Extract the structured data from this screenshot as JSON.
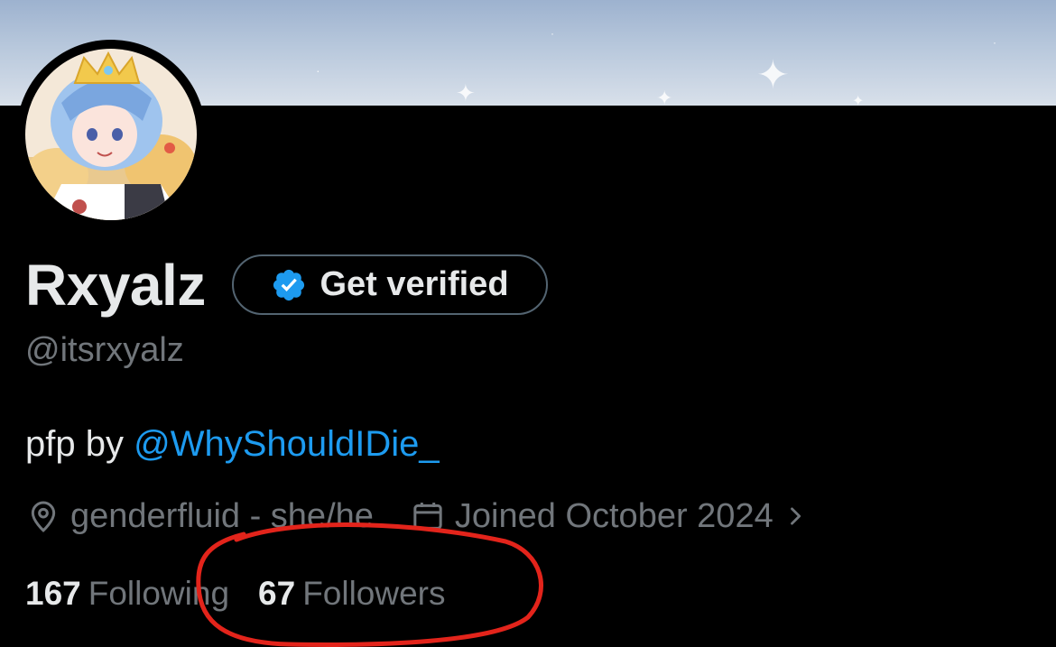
{
  "profile": {
    "display_name": "Rxyalz",
    "handle": "@itsrxyalz",
    "get_verified_label": "Get verified",
    "bio_prefix": "pfp by",
    "bio_mention": "@WhyShouldIDie_",
    "location": "genderfluid - she/he",
    "joined": "Joined October 2024",
    "following_count": "167",
    "following_label": "Following",
    "followers_count": "67",
    "followers_label": "Followers"
  },
  "colors": {
    "background": "#000000",
    "text_primary": "#e7e9ea",
    "text_secondary": "#71767b",
    "accent": "#1d9bf0",
    "annotation": "#e3241b"
  },
  "icons": {
    "verified": "verified-badge-icon",
    "location": "location-pin-icon",
    "calendar": "calendar-icon",
    "chevron": "chevron-right-icon"
  },
  "annotation": {
    "shape": "hand-drawn-ellipse",
    "target": "followers-stat"
  }
}
